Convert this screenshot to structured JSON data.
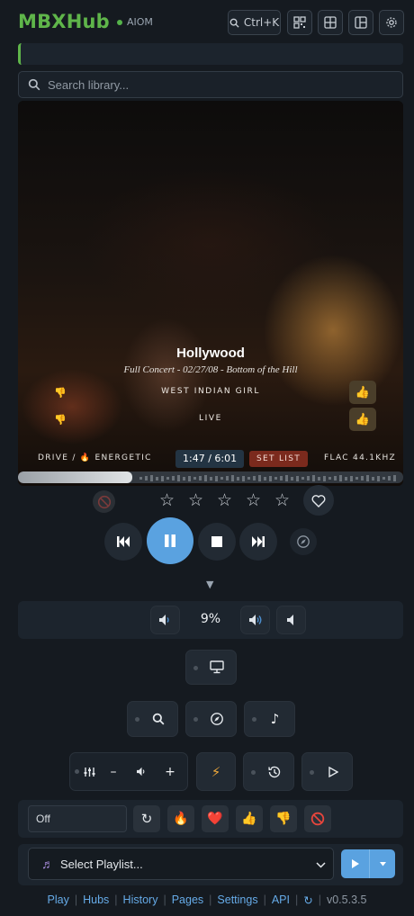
{
  "header": {
    "title": "MBXHub",
    "status": "AIOM",
    "shortcut": "Ctrl+K"
  },
  "search": {
    "placeholder": "Search library..."
  },
  "now_playing": {
    "title": "Hollywood",
    "subtitle": "Full Concert - 02/27/08 - Bottom of the Hill",
    "artist": "WEST INDIAN GIRL",
    "tag": "LIVE",
    "mood": "DRIVE / 🔥 ENERGETIC",
    "time": "1:47 / 6:01",
    "setlist_label": "SET LIST",
    "format": "FLAC 44.1KHZ",
    "progress": 0.296
  },
  "rating": {
    "stars": 0,
    "max": 5
  },
  "volume": {
    "value": "9%"
  },
  "mood_filter": {
    "value": "Off"
  },
  "playlist": {
    "placeholder": "Select Playlist..."
  },
  "footer": {
    "links": [
      "Play",
      "Hubs",
      "History",
      "Pages",
      "Settings",
      "API"
    ],
    "version": "v0.5.3.5"
  }
}
